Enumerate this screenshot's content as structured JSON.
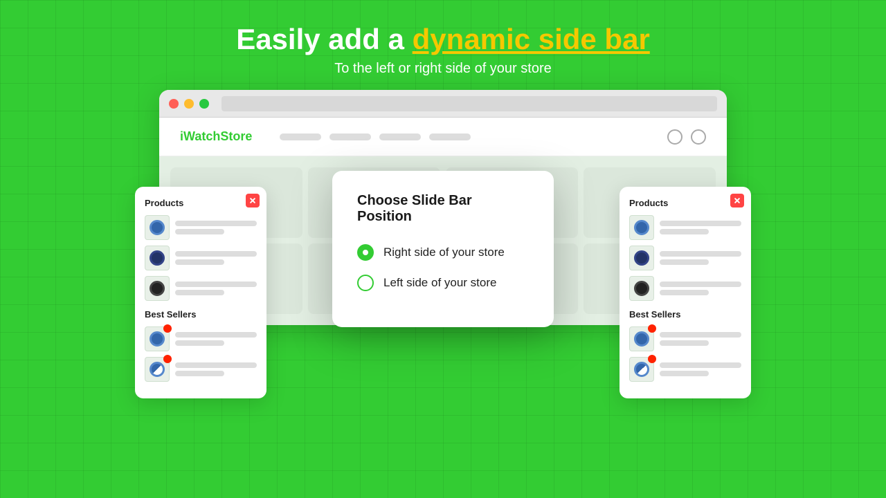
{
  "header": {
    "title_plain": "Easily add a ",
    "title_highlight": "dynamic side bar",
    "subtitle": "To the left or right side of your store"
  },
  "browser": {
    "addressbar_placeholder": ""
  },
  "store": {
    "logo_text": "iWatch",
    "logo_highlight": "Store"
  },
  "modal": {
    "title": "Choose Slide Bar Position",
    "options": [
      {
        "id": "right",
        "label": "Right side of your store",
        "selected": true
      },
      {
        "id": "left",
        "label": "Left side of your store",
        "selected": false
      }
    ]
  },
  "sidebar": {
    "section1": "Products",
    "section2": "Best Sellers",
    "close_label": "×"
  }
}
